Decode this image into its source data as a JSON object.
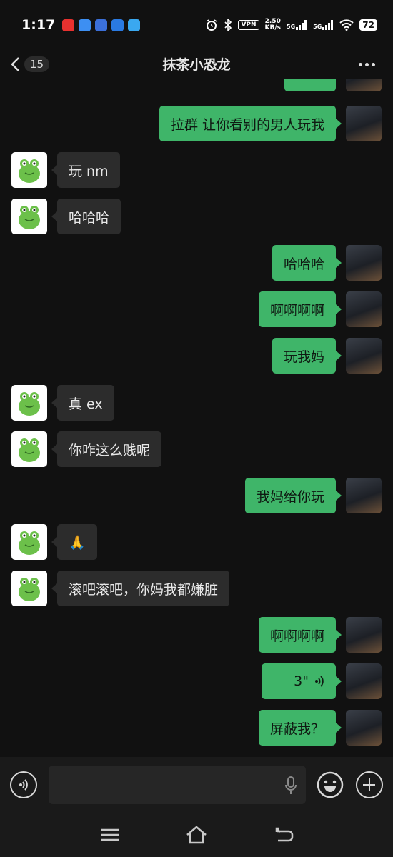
{
  "status_bar": {
    "time": "1:17",
    "vpn": "VPN",
    "speed_value": "2.50",
    "speed_unit": "KB/s",
    "sim1": "5G",
    "sim2": "5G",
    "battery": "72"
  },
  "header": {
    "unread_count": "15",
    "title": "抹茶小恐龙"
  },
  "messages": [
    {
      "from": "me",
      "text": ""
    },
    {
      "from": "me",
      "text": "拉群 让你看别的男人玩我"
    },
    {
      "from": "them",
      "text": "玩 nm"
    },
    {
      "from": "them",
      "text": "哈哈哈"
    },
    {
      "from": "me",
      "text": "哈哈哈"
    },
    {
      "from": "me",
      "text": "啊啊啊啊"
    },
    {
      "from": "me",
      "text": "玩我妈"
    },
    {
      "from": "them",
      "text": "真 ex"
    },
    {
      "from": "them",
      "text": "你咋这么贱呢"
    },
    {
      "from": "me",
      "text": "我妈给你玩"
    },
    {
      "from": "them",
      "text": "🙏"
    },
    {
      "from": "them",
      "text": "滚吧滚吧，你妈我都嫌脏"
    },
    {
      "from": "me",
      "text": "啊啊啊啊"
    },
    {
      "from": "me",
      "type": "voice",
      "duration": "3\""
    },
    {
      "from": "me",
      "text": "屏蔽我？"
    }
  ],
  "colors": {
    "background": "#111111",
    "my_bubble": "#3fb569",
    "their_bubble": "#2c2c2c"
  },
  "icons": [
    "back-chevron-icon",
    "more-icon",
    "voice-input-icon",
    "mic-icon",
    "emoji-icon",
    "plus-icon",
    "menu-icon",
    "home-icon",
    "back-nav-icon"
  ]
}
